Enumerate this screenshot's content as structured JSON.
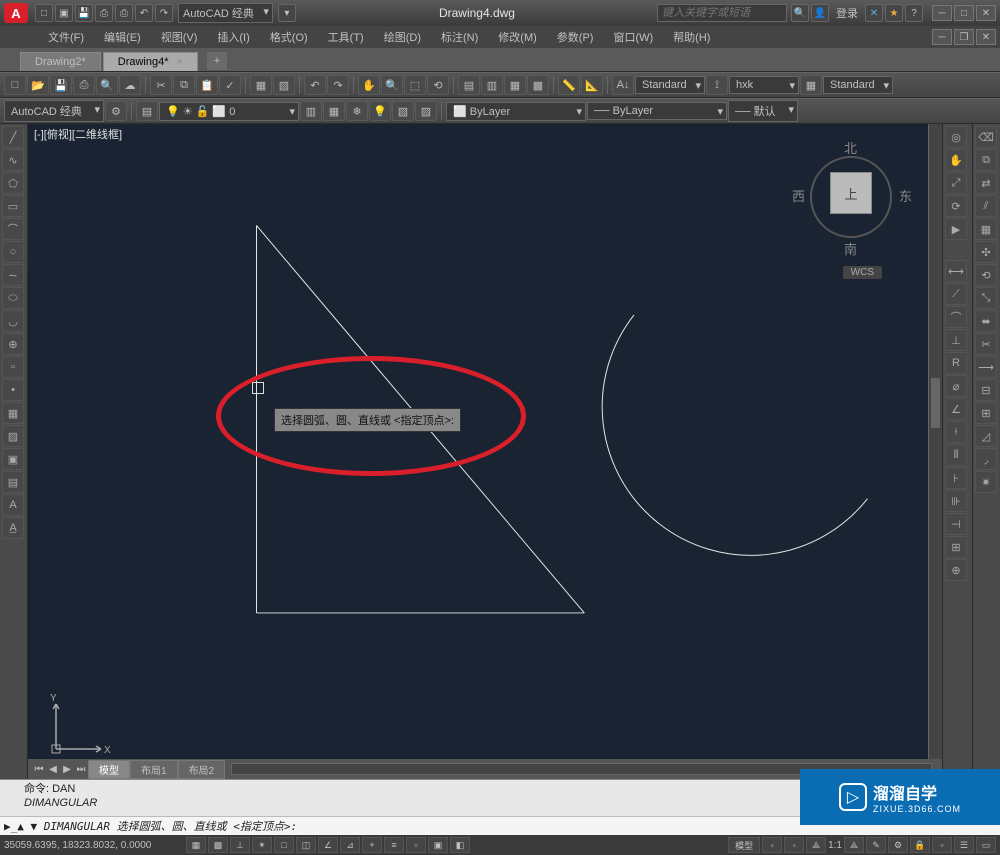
{
  "title": "Drawing4.dwg",
  "workspace": "AutoCAD 经典",
  "search_placeholder": "键入关键字或短语",
  "login_label": "登录",
  "menus": [
    "文件(F)",
    "编辑(E)",
    "视图(V)",
    "插入(I)",
    "格式(O)",
    "工具(T)",
    "绘图(D)",
    "标注(N)",
    "修改(M)",
    "参数(P)",
    "窗口(W)",
    "帮助(H)"
  ],
  "tabs": [
    {
      "label": "Drawing2*",
      "active": false
    },
    {
      "label": "Drawing4*",
      "active": true
    }
  ],
  "style_combo": "AutoCAD 经典",
  "layer_combo": "0",
  "textstyle1": "Standard",
  "textstyle2": "hxk",
  "textstyle3": "Standard",
  "bylayer1": "ByLayer",
  "bylayer2": "ByLayer",
  "bylayer3": "默认",
  "viewport_label": "[-][俯视][二维线框]",
  "viewcube": {
    "n": "北",
    "s": "南",
    "e": "东",
    "w": "西",
    "top": "上",
    "wcs": "WCS"
  },
  "tooltip_text": "选择圆弧、圆、直线或 <指定顶点>:",
  "ucs": {
    "x": "X",
    "y": "Y"
  },
  "layout_tabs": [
    "模型",
    "布局1",
    "布局2"
  ],
  "cmd_history1": "命令: DAN",
  "cmd_history2": "DIMANGULAR",
  "cmd_prompt": "▶_▲ ▼ DIMANGULAR 选择圆弧、圆、直线或 <指定顶点>:",
  "status_coords": "35059.6395, 18323.8032, 0.0000",
  "status_model": "模型",
  "status_scale": "1:1",
  "watermark_title": "溜溜自学",
  "watermark_sub": "ZIXUE.3D66.COM"
}
